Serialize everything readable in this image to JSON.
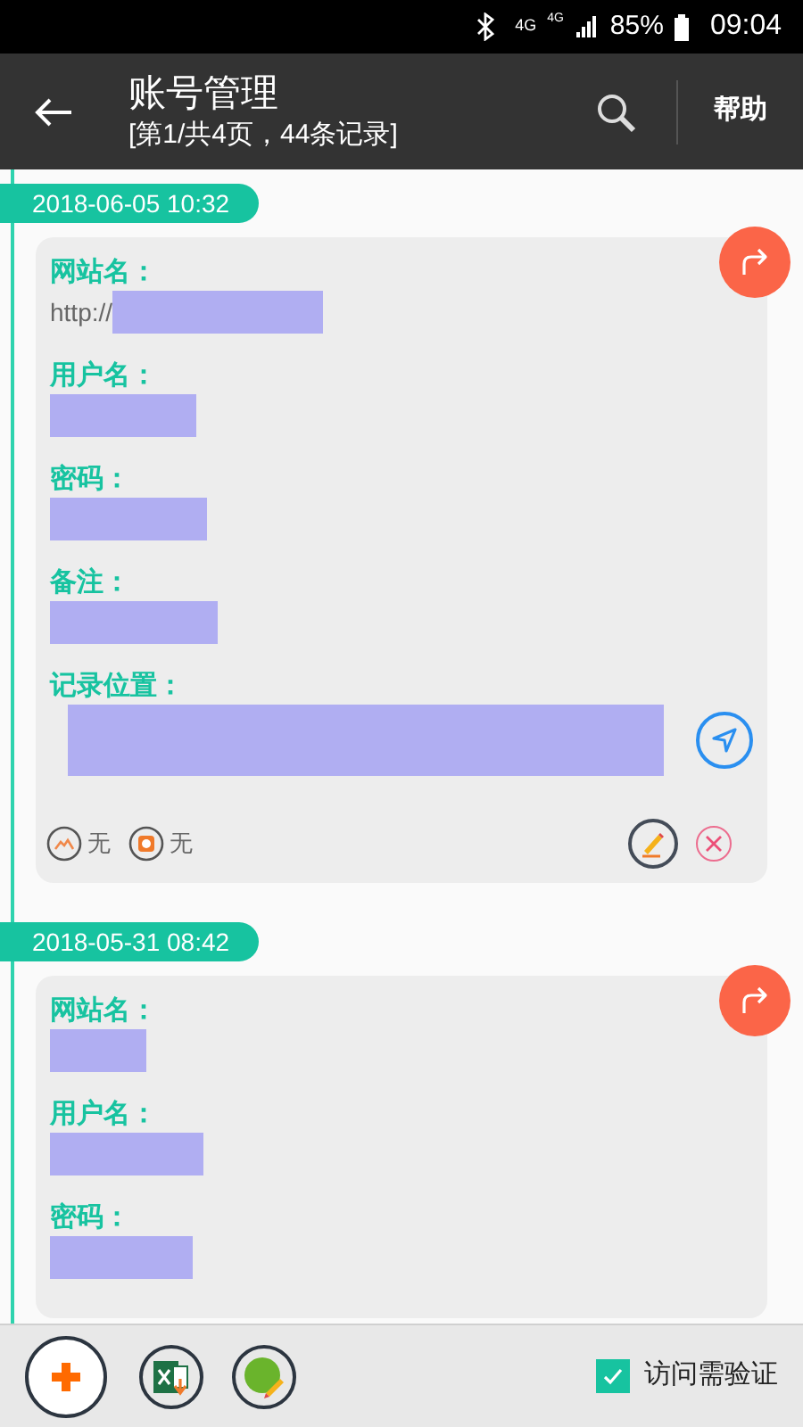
{
  "status_bar": {
    "network": [
      "4G",
      "4G"
    ],
    "battery": "85%",
    "time": "09:04"
  },
  "header": {
    "title": "账号管理",
    "subtitle": "[第1/共4页，44条记录]",
    "help": "帮助"
  },
  "records": [
    {
      "date": "2018-06-05 10:32",
      "fields": [
        {
          "kind": "text",
          "label": "网站名：",
          "value": "http://",
          "redacted": true
        },
        {
          "kind": "text",
          "label": "用户名：",
          "redacted": true
        },
        {
          "kind": "text",
          "label": "密码：",
          "redacted": true
        },
        {
          "kind": "text",
          "label": "备注：",
          "redacted": true
        },
        {
          "kind": "location",
          "label": "记录位置：",
          "redacted": true
        }
      ],
      "footer": {
        "photos": "无",
        "alarm": "无"
      }
    },
    {
      "date": "2018-05-31 08:42",
      "fields": [
        {
          "kind": "text",
          "label": "网站名：",
          "redacted": true
        },
        {
          "kind": "text",
          "label": "用户名：",
          "redacted": true
        },
        {
          "kind": "text",
          "label": "密码：",
          "redacted": true
        }
      ]
    }
  ],
  "verify": {
    "label": "访问需验证",
    "checked": true
  }
}
